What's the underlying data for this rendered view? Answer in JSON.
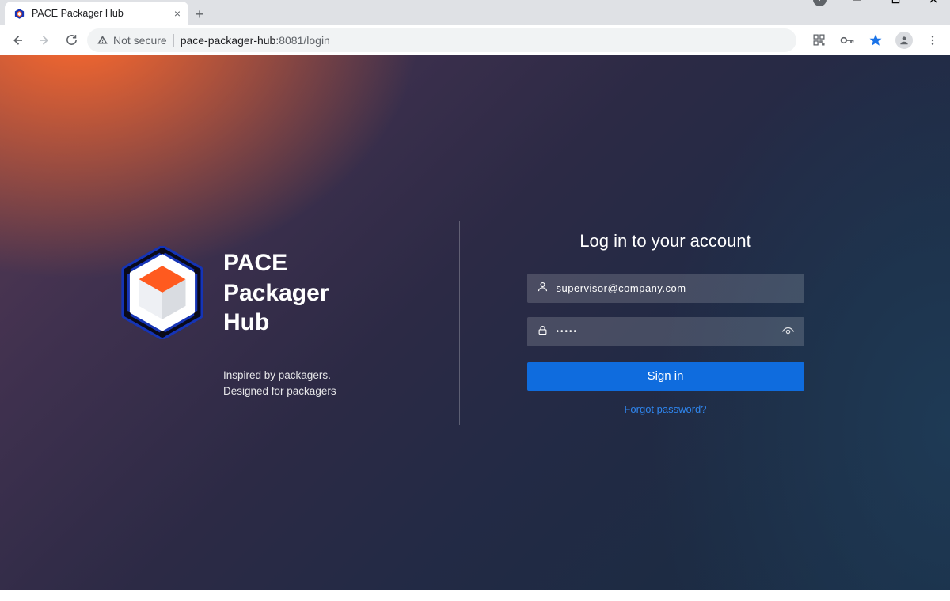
{
  "window": {
    "tab_title": "PACE Packager Hub",
    "minimize_icon": "minimize-icon",
    "maximize_icon": "maximize-icon",
    "close_icon": "close-icon"
  },
  "browser": {
    "not_secure_label": "Not secure",
    "url_host": "pace-packager-hub",
    "url_path": ":8081/login"
  },
  "brand": {
    "line1": "PACE",
    "line2": "Packager",
    "line3": "Hub",
    "tagline": "Inspired by packagers. Designed for packagers"
  },
  "login": {
    "heading": "Log in to your account",
    "username_value": "supervisor@company.com",
    "password_masked": "•••••",
    "signin_label": "Sign in",
    "forgot_label": "Forgot password?"
  }
}
